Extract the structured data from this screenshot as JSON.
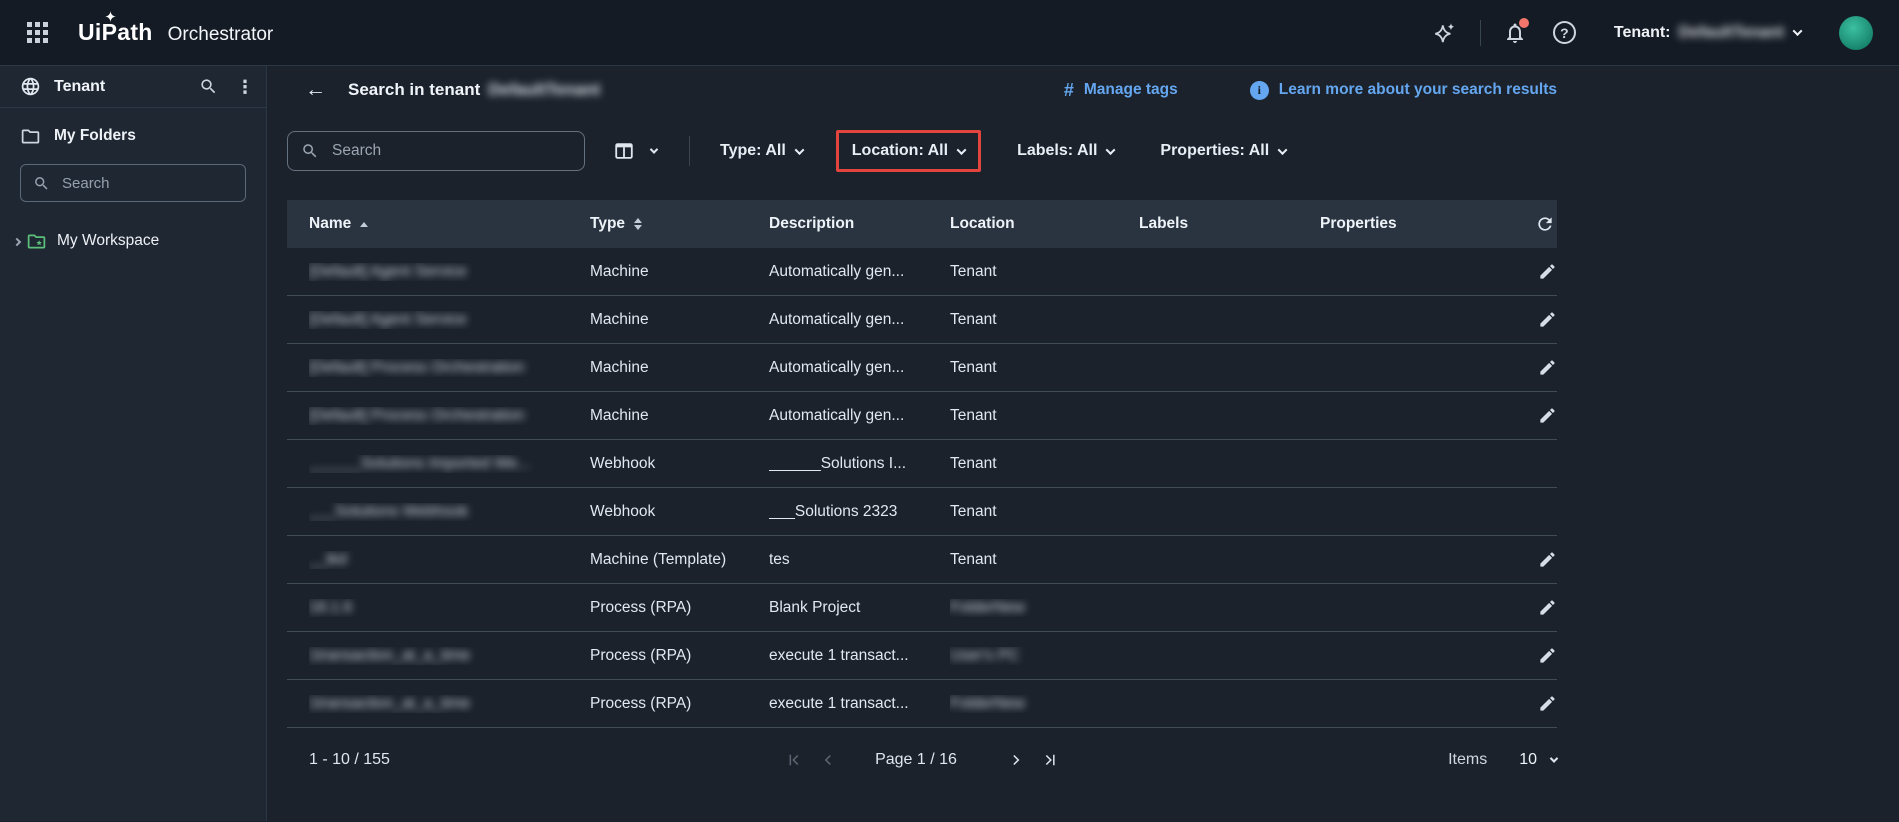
{
  "topbar": {
    "logo": "UiPath",
    "product": "Orchestrator",
    "tenant_label": "Tenant:",
    "tenant_name": "DefaultTenant",
    "tenant_name_blurred": true
  },
  "sidebar": {
    "title": "Tenant",
    "my_folders": "My Folders",
    "search_placeholder": "Search",
    "my_workspace": "My Workspace"
  },
  "main": {
    "header": {
      "title": "Search in tenant",
      "tenant_name": "DefaultTenant",
      "tenant_name_blurred": true,
      "manage_tags": "Manage tags",
      "learn_more": "Learn more about your search results"
    },
    "filters": {
      "search_placeholder": "Search",
      "type": "Type: All",
      "location": "Location: All",
      "labels": "Labels: All",
      "properties": "Properties: All",
      "location_highlighted": true
    },
    "table": {
      "columns": [
        "Name",
        "Type",
        "Description",
        "Location",
        "Labels",
        "Properties"
      ],
      "sort": {
        "column": "Name",
        "direction": "asc"
      },
      "rows": [
        {
          "name": "[Default] Agent Service",
          "name_blurred": true,
          "type": "Machine",
          "description": "Automatically gen...",
          "location": "Tenant",
          "location_blurred": false,
          "labels": "",
          "properties": "",
          "editable": true
        },
        {
          "name": "[Default] Agent Service",
          "name_blurred": true,
          "type": "Machine",
          "description": "Automatically gen...",
          "location": "Tenant",
          "location_blurred": false,
          "labels": "",
          "properties": "",
          "editable": true
        },
        {
          "name": "[Default] Process Orchestration",
          "name_blurred": true,
          "type": "Machine",
          "description": "Automatically gen...",
          "location": "Tenant",
          "location_blurred": false,
          "labels": "",
          "properties": "",
          "editable": true
        },
        {
          "name": "[Default] Process Orchestration",
          "name_blurred": true,
          "type": "Machine",
          "description": "Automatically gen...",
          "location": "Tenant",
          "location_blurred": false,
          "labels": "",
          "properties": "",
          "editable": true
        },
        {
          "name": "______Solutions Imported We...",
          "name_blurred": true,
          "type": "Webhook",
          "description": "______Solutions I...",
          "location": "Tenant",
          "location_blurred": false,
          "labels": "",
          "properties": "",
          "editable": false
        },
        {
          "name": "___Solutions Webhook",
          "name_blurred": true,
          "type": "Webhook",
          "description": "___Solutions 2323",
          "location": "Tenant",
          "location_blurred": false,
          "labels": "",
          "properties": "",
          "editable": false
        },
        {
          "name": "__tkd",
          "name_blurred": true,
          "type": "Machine (Template)",
          "description": "tes",
          "location": "Tenant",
          "location_blurred": false,
          "labels": "",
          "properties": "",
          "editable": true
        },
        {
          "name": "18.1.6",
          "name_blurred": true,
          "type": "Process (RPA)",
          "description": "Blank Project",
          "location": "FolderNew",
          "location_blurred": true,
          "labels": "",
          "properties": "",
          "editable": true
        },
        {
          "name": "1transaction_at_a_time",
          "name_blurred": true,
          "type": "Process (RPA)",
          "description": "execute 1 transact...",
          "location": "User's PC",
          "location_blurred": true,
          "labels": "",
          "properties": "",
          "editable": true
        },
        {
          "name": "1transaction_at_a_time",
          "name_blurred": true,
          "type": "Process (RPA)",
          "description": "execute 1 transact...",
          "location": "FolderNew",
          "location_blurred": true,
          "labels": "",
          "properties": "",
          "editable": true
        }
      ]
    },
    "pagination": {
      "range": "1 - 10 / 155",
      "page": "Page 1 / 16",
      "items_label": "Items",
      "items_value": "10"
    }
  },
  "icons": {
    "help_glyph": "?",
    "info_glyph": "i",
    "hash_glyph": "#",
    "back_glyph": "←",
    "kebab_glyph": "⋮",
    "app_launcher": "3x3-grid",
    "ai_sparkle": "four-point-star",
    "notifications": "bell-with-dot",
    "tenant_menu": "chevron-down",
    "globe": "globe",
    "search": "magnifier",
    "folder": "folder",
    "workspace_folder": "folder-green",
    "expand": "chevron-right",
    "column_chooser": "table-columns",
    "sort_asc": "triangle-up",
    "sort_both": "triangle-up-down",
    "refresh": "circular-arrow",
    "edit": "pencil",
    "first_page": "bar-chevron-left",
    "prev_page": "chevron-left",
    "next_page": "chevron-right",
    "last_page": "chevron-bar-right"
  },
  "colors": {
    "accent_blue": "#64a7f0",
    "annotation_red": "#e2453d",
    "avatar_teal": "#20a189",
    "notification_dot": "#f2766b",
    "topbar_bg": "#151b24",
    "sidebar_bg": "#1f2732",
    "main_bg": "#1b222c",
    "table_header_bg": "#2a3441"
  }
}
